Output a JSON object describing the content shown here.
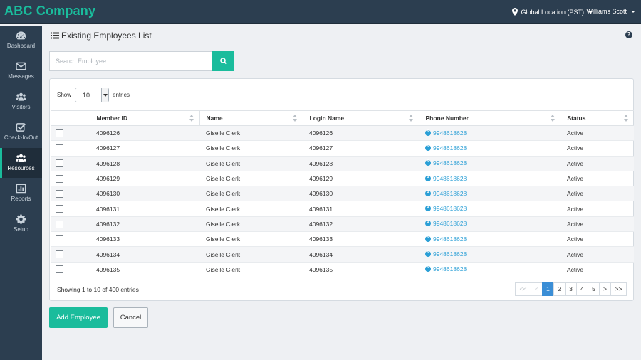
{
  "app": {
    "brand": "ABC Company",
    "location": "Global Location (PST)",
    "user": "Williams Scott",
    "accent_color": "#1abc9c",
    "sidebar_color": "#2c3e50"
  },
  "sidebar": {
    "items": [
      {
        "label": "Dashboard",
        "icon": "dashboard-icon"
      },
      {
        "label": "Messages",
        "icon": "envelope-icon"
      },
      {
        "label": "Visitors",
        "icon": "users-icon"
      },
      {
        "label": "Check-In/Out",
        "icon": "checkbox-icon"
      },
      {
        "label": "Resources",
        "icon": "users-icon",
        "active": true
      },
      {
        "label": "Reports",
        "icon": "bar-chart-icon"
      },
      {
        "label": "Setup",
        "icon": "gear-icon"
      }
    ]
  },
  "main": {
    "title": "Existing Employees List",
    "search_placeholder": "Search Employee",
    "show_label": "Show",
    "entries_value": "10",
    "entries_label": "entries",
    "columns": [
      "Member ID",
      "Name",
      "Login Name",
      "Phone Number",
      "Status"
    ],
    "rows": [
      {
        "member_id": "4096126",
        "name": "Giselle Clerk",
        "login": "4096126",
        "phone": "9948618628",
        "status": "Active"
      },
      {
        "member_id": "4096127",
        "name": "Giselle Clerk",
        "login": "4096127",
        "phone": "9948618628",
        "status": "Active"
      },
      {
        "member_id": "4096128",
        "name": "Giselle Clerk",
        "login": "4096128",
        "phone": "9948618628",
        "status": "Active"
      },
      {
        "member_id": "4096129",
        "name": "Giselle Clerk",
        "login": "4096129",
        "phone": "9948618628",
        "status": "Active"
      },
      {
        "member_id": "4096130",
        "name": "Giselle Clerk",
        "login": "4096130",
        "phone": "9948618628",
        "status": "Active"
      },
      {
        "member_id": "4096131",
        "name": "Giselle Clerk",
        "login": "4096131",
        "phone": "9948618628",
        "status": "Active"
      },
      {
        "member_id": "4096132",
        "name": "Giselle Clerk",
        "login": "4096132",
        "phone": "9948618628",
        "status": "Active"
      },
      {
        "member_id": "4096133",
        "name": "Giselle Clerk",
        "login": "4096133",
        "phone": "9948618628",
        "status": "Active"
      },
      {
        "member_id": "4096134",
        "name": "Giselle Clerk",
        "login": "4096134",
        "phone": "9948618628",
        "status": "Active"
      },
      {
        "member_id": "4096135",
        "name": "Giselle Clerk",
        "login": "4096135",
        "phone": "9948618628",
        "status": "Active"
      }
    ],
    "showing_text": "Showing 1 to 10 of 400 entries",
    "pagination": {
      "first": "<<",
      "prev": "<",
      "pages": [
        "1",
        "2",
        "3",
        "4",
        "5"
      ],
      "current": "1",
      "next": ">",
      "last": ">>"
    },
    "add_label": "Add Employee",
    "cancel_label": "Cancel"
  }
}
